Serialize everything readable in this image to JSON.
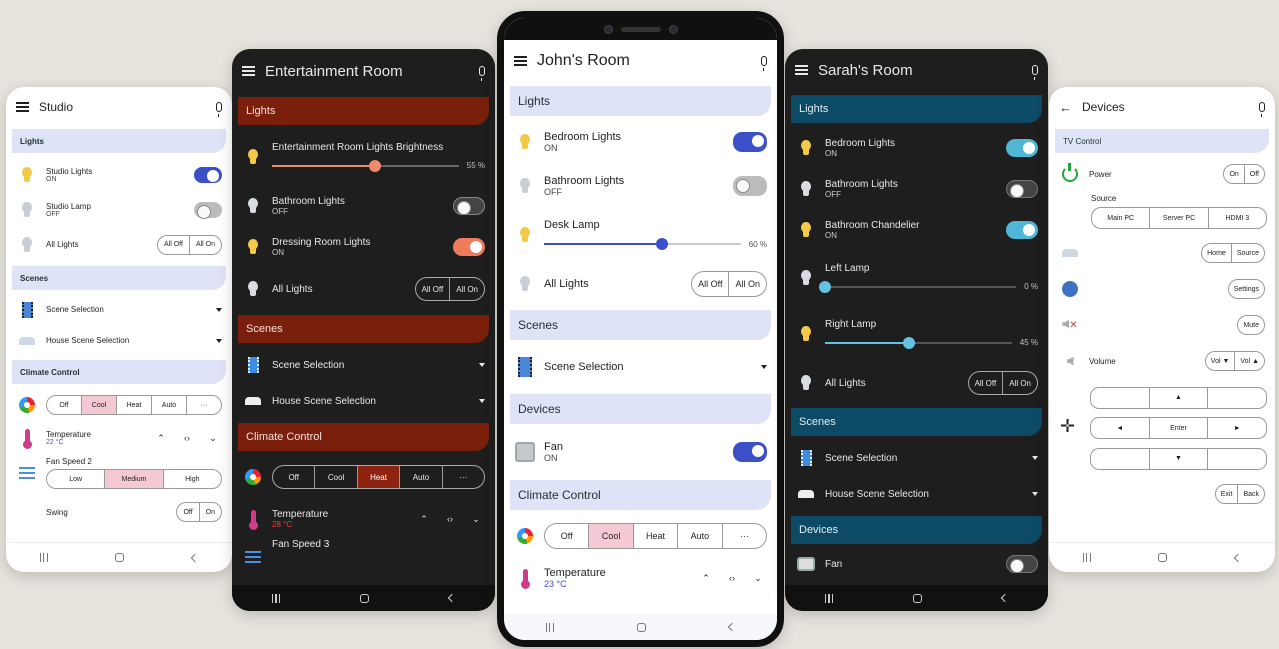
{
  "studio": {
    "title": "Studio",
    "sections": {
      "lights": "Lights",
      "scenes": "Scenes",
      "climate": "Climate Control"
    },
    "lights": [
      {
        "name": "Studio Lights",
        "state": "ON"
      },
      {
        "name": "Studio Lamp",
        "state": "OFF"
      }
    ],
    "all_lights": {
      "label": "All Lights",
      "off": "All Off",
      "on": "All On"
    },
    "scenes": [
      "Scene Selection",
      "House Scene Selection"
    ],
    "climate_modes": [
      "Off",
      "Cool",
      "Heat",
      "Auto",
      "···"
    ],
    "climate_selected": "Cool",
    "temperature": {
      "label": "Temperature",
      "value": "22 °C"
    },
    "fan_speed": {
      "label": "Fan Speed",
      "value": "2",
      "options": [
        "Low",
        "Medium",
        "High"
      ],
      "selected": "Medium"
    },
    "swing": {
      "label": "Swing",
      "off": "Off",
      "on": "On"
    }
  },
  "entertainment": {
    "title": "Entertainment Room",
    "sections": {
      "lights": "Lights",
      "scenes": "Scenes",
      "climate": "Climate Control"
    },
    "brightness": {
      "name": "Entertainment Room Lights Brightness",
      "pct": "55 %",
      "value": 0.55
    },
    "lights": [
      {
        "name": "Bathroom Lights",
        "state": "OFF"
      },
      {
        "name": "Dressing Room Lights",
        "state": "ON"
      }
    ],
    "all_lights": {
      "label": "All Lights",
      "off": "All Off",
      "on": "All On"
    },
    "scenes": [
      "Scene Selection",
      "House Scene Selection"
    ],
    "climate_modes": [
      "Off",
      "Cool",
      "Heat",
      "Auto",
      "···"
    ],
    "climate_selected": "Heat",
    "temperature": {
      "label": "Temperature",
      "value": "28 °C"
    },
    "fan_speed": {
      "label": "Fan Speed",
      "value": "3"
    }
  },
  "john": {
    "title": "John's Room",
    "sections": {
      "lights": "Lights",
      "scenes": "Scenes",
      "devices": "Devices",
      "climate": "Climate Control"
    },
    "lights": [
      {
        "name": "Bedroom Lights",
        "state": "ON"
      },
      {
        "name": "Bathroom Lights",
        "state": "OFF"
      }
    ],
    "desk_lamp": {
      "name": "Desk Lamp",
      "pct": "60 %",
      "value": 0.6
    },
    "all_lights": {
      "label": "All Lights",
      "off": "All Off",
      "on": "All On"
    },
    "scene": "Scene Selection",
    "fan": {
      "name": "Fan",
      "state": "ON"
    },
    "climate_modes": [
      "Off",
      "Cool",
      "Heat",
      "Auto",
      "···"
    ],
    "climate_selected": "Cool",
    "temperature": {
      "label": "Temperature",
      "value": "23 °C"
    }
  },
  "sarah": {
    "title": "Sarah's Room",
    "sections": {
      "lights": "Lights",
      "scenes": "Scenes",
      "devices": "Devices"
    },
    "lights": [
      {
        "name": "Bedroom Lights",
        "state": "ON"
      },
      {
        "name": "Bathroom Lights",
        "state": "OFF"
      },
      {
        "name": "Bathroom Chandelier",
        "state": "ON"
      }
    ],
    "left_lamp": {
      "name": "Left Lamp",
      "pct": "0 %",
      "value": 0
    },
    "right_lamp": {
      "name": "Right Lamp",
      "pct": "45 %",
      "value": 0.45
    },
    "all_lights": {
      "label": "All Lights",
      "off": "All Off",
      "on": "All On"
    },
    "scenes": [
      "Scene Selection",
      "House Scene Selection"
    ],
    "fan": {
      "name": "Fan"
    }
  },
  "devices": {
    "title": "Devices",
    "section": "TV Control",
    "power": {
      "label": "Power",
      "on": "On",
      "off": "Off"
    },
    "source": {
      "label": "Source",
      "options": [
        "Main PC",
        "Server PC",
        "HDMI 3"
      ]
    },
    "home": "Home",
    "source_btn": "Source",
    "settings": "Settings",
    "mute": "Mute",
    "volume": {
      "label": "Volume",
      "down": "Vol ▼",
      "up": "Vol ▲"
    },
    "dpad": {
      "up": "▲",
      "left": "◄",
      "enter": "Enter",
      "right": "►",
      "down": "▼"
    },
    "exit": "Exit",
    "back": "Back"
  }
}
